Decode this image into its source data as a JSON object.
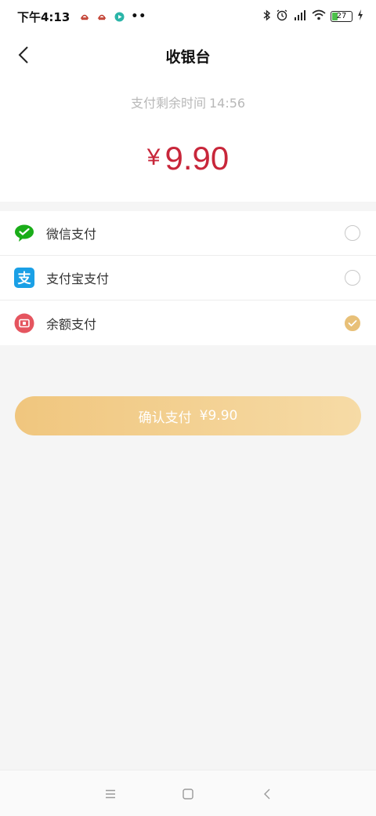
{
  "status_bar": {
    "time": "下午4:13",
    "dots": "••",
    "battery_level": "27",
    "icons": [
      "notification-icon",
      "notification-icon",
      "play-icon",
      "bluetooth-icon",
      "alarm-icon",
      "signal-icon",
      "wifi-icon",
      "battery-icon",
      "charging-icon"
    ]
  },
  "header": {
    "title": "收银台",
    "back_icon": "chevron-left-icon"
  },
  "payment": {
    "countdown_label": "支付剩余时间",
    "countdown_time": "14:56",
    "currency_symbol": "¥",
    "amount": "9.90"
  },
  "methods": [
    {
      "label": "微信支付",
      "icon": "wechat-pay-icon",
      "color": "#1aad19",
      "selected": false
    },
    {
      "label": "支付宝支付",
      "icon": "alipay-icon",
      "color": "#1aa0e6",
      "selected": false
    },
    {
      "label": "余额支付",
      "icon": "balance-icon",
      "color": "#e5555f",
      "selected": true
    }
  ],
  "confirm_button": {
    "label": "确认支付",
    "amount": "¥9.90"
  },
  "colors": {
    "accent": "#c8263a",
    "button_start": "#f0c67e",
    "button_end": "#f6dba6",
    "selected_radio": "#e8c078"
  },
  "nav_bar": {
    "icons": [
      "menu-icon",
      "home-square-icon",
      "back-triangle-icon"
    ]
  }
}
